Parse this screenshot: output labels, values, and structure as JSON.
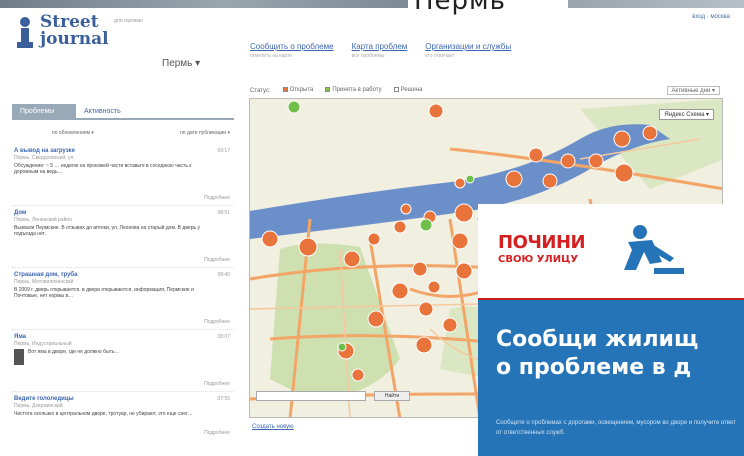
{
  "header": {
    "city_title": "Пермь",
    "logo_line1": "Street",
    "logo_line2": "journal",
    "logo_tag": "для горожан",
    "city_select": "Пермь ▾",
    "top_links": "вход · москва"
  },
  "nav": [
    {
      "label": "Сообщить о проблеме",
      "sub": "отметить на карте"
    },
    {
      "label": "Карта проблем",
      "sub": "все проблемы"
    },
    {
      "label": "Организации и службы",
      "sub": "кто отвечает"
    }
  ],
  "left": {
    "tabs": [
      "Проблемы",
      "Активность"
    ],
    "sort_left": "по обновлениям ▾",
    "sort_right": "по дате публикации ▾",
    "items": [
      {
        "title": "А вывод на загрузке",
        "meta": "Пермь, Свердловский, ул.",
        "text": "Обсуждение: ~ 5 … неделю на проезжей части вставьте в соседнюю часть к дорожным на ведь… ",
        "time": "09:17",
        "more": "Подробнее"
      },
      {
        "title": "Дом",
        "meta": "Пермь, Ленинский район",
        "text": "Вызвали Пермские. В отзывах до аптеки, ул. Леонова на старый дом. В дверь у подъезда нет.",
        "time": "08:51",
        "more": "Подробнее"
      },
      {
        "title": "Страшная дом, труба",
        "meta": "Пермь, Мотовилихинский",
        "text": "В 2009 г. дверь открывается, в двери открываются, информация, Пермские и Почтовые, нет нормы в…",
        "time": "08:40",
        "more": "Подробнее"
      },
      {
        "title": "Яма",
        "meta": "Пермь, Индустриальный",
        "text": "Вот яма в дворе, где не должно быть…",
        "time": "08:07",
        "more": "Подробнее"
      },
      {
        "title": "Ведите гололедицы",
        "meta": "Пермь, Дзержинский",
        "text": "Чистота скользко в центральном дворе, тротуар, не убирают, это еще снег…",
        "time": "07:55",
        "more": "Подробнее"
      }
    ]
  },
  "filters": {
    "label": "Статус:",
    "opt1": "Открыта",
    "opt2": "Принята в работу",
    "opt3": "Решена",
    "right": "Активные дни ▾"
  },
  "map": {
    "type_button": "Яндекс Схема ▾",
    "search_button": "Найти",
    "footer_link": "Создать новую"
  },
  "ad": {
    "logo_line1": "ПОЧИНИ",
    "logo_line2": "СВОЮ УЛИЦУ",
    "headline_line1": "Сообщи жилищ",
    "headline_line2": "о проблеме в д",
    "sub": "Сообщите о проблемах с дорогами, освещением, мусором во дворе и получите ответ от ответственных служб."
  },
  "colors": {
    "marker": "#e8743b",
    "road": "#f3a567",
    "water": "#6b8fc9",
    "park": "#cfe0b0",
    "ad_blue": "#2574b8",
    "ad_red": "#d42020"
  }
}
